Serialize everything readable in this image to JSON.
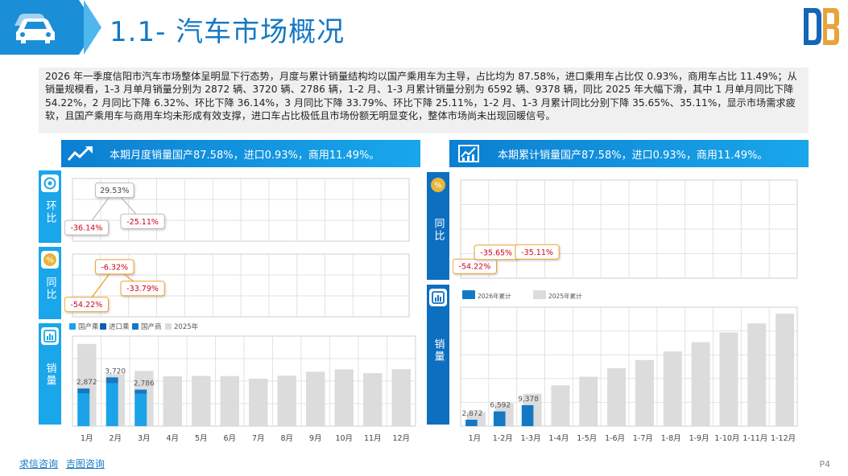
{
  "header": {
    "title": "1.1- 汽车市场概况"
  },
  "summary": "2026 年一季度信阳市汽车市场整体呈明显下行态势，月度与累计销量结构均以国产乘用车为主导，占比均为 87.58%，进口乘用车占比仅 0.93%，商用车占比 11.49%；从销量规模看，1-3 月单月销量分别为 2872 辆、3720 辆、2786 辆，1-2 月、1-3 月累计销量分别为 6592 辆、9378 辆，同比 2025 年大幅下滑，其中 1 月单月同比下降 54.22%，2 月同比下降 6.32%、环比下降 36.14%，3 月同比下降 33.79%、环比下降 25.11%，1-2 月、1-3 月累计同比分别下降 35.65%、35.11%，显示市场需求疲软，且国产乘用车与商用车均未形成有效支撑，进口车占比极低且市场份额无明显变化，整体市场尚未出现回暖信号。",
  "left_panel": {
    "banner": "本期月度销量国产87.58%，进口0.93%，商用11.49%。",
    "tab_mom": "环比",
    "tab_yoy": "同比",
    "tab_sales": "销量"
  },
  "right_panel": {
    "banner": "本期累计销量国产87.58%，进口0.93%，商用11.49%。",
    "tab_yoy": "同比",
    "tab_sales": "销量"
  },
  "footer": {
    "link1": "求信咨询",
    "link2": "吉图咨询",
    "page": "P4"
  },
  "colors": {
    "accent": "#1a8fd8",
    "domestic": "#1aa3e8",
    "import": "#0d5fb0",
    "commercial": "#1479c4",
    "prev_year": "#dcdcdc",
    "negative_label": "#d0021b"
  },
  "chart_data": [
    {
      "id": "monthly_mom",
      "type": "line",
      "categories": [
        "1月",
        "2月",
        "3月",
        "4月",
        "5月",
        "6月",
        "7月",
        "8月",
        "9月",
        "10月",
        "11月",
        "12月"
      ],
      "series": [
        {
          "values": [
            -36.14,
            29.53,
            -25.11,
            null,
            null,
            null,
            null,
            null,
            null,
            null,
            null,
            null
          ]
        }
      ],
      "data_labels": [
        "-36.14%",
        "29.53%",
        "-25.11%"
      ]
    },
    {
      "id": "monthly_yoy",
      "type": "line",
      "categories": [
        "1月",
        "2月",
        "3月",
        "4月",
        "5月",
        "6月",
        "7月",
        "8月",
        "9月",
        "10月",
        "11月",
        "12月"
      ],
      "series": [
        {
          "values": [
            -54.22,
            -6.32,
            -33.79,
            null,
            null,
            null,
            null,
            null,
            null,
            null,
            null,
            null
          ]
        }
      ],
      "data_labels": [
        "-54.22%",
        "-6.32%",
        "-33.79%"
      ]
    },
    {
      "id": "monthly_sales",
      "type": "bar",
      "categories": [
        "1月",
        "2月",
        "3月",
        "4月",
        "5月",
        "6月",
        "7月",
        "8月",
        "9月",
        "10月",
        "11月",
        "12月"
      ],
      "legend": [
        "国产乘",
        "进口乘",
        "国产商",
        "2025年"
      ],
      "series": [
        {
          "name": "2025年",
          "values": [
            6270,
            3970,
            4210,
            3800,
            3830,
            3820,
            3620,
            3850,
            4150,
            4330,
            4040,
            4350
          ]
        },
        {
          "name": "2026年",
          "values": [
            2872,
            3720,
            2786,
            null,
            null,
            null,
            null,
            null,
            null,
            null,
            null,
            null
          ]
        }
      ],
      "data_labels": [
        "2,872",
        "3,720",
        "2,786"
      ]
    },
    {
      "id": "cumulative_yoy",
      "type": "line",
      "categories": [
        "1月",
        "1-2月",
        "1-3月",
        "1-4月",
        "1-5月",
        "1-6月",
        "1-7月",
        "1-8月",
        "1-9月",
        "1-10月",
        "1-11月",
        "1-12月"
      ],
      "series": [
        {
          "values": [
            -54.22,
            -35.65,
            -35.11,
            null,
            null,
            null,
            null,
            null,
            null,
            null,
            null,
            null
          ]
        }
      ],
      "data_labels": [
        "-54.22%",
        "-35.65%",
        "-35.11%"
      ]
    },
    {
      "id": "cumulative_sales",
      "type": "bar",
      "categories": [
        "1月",
        "1-2月",
        "1-3月",
        "1-4月",
        "1-5月",
        "1-6月",
        "1-7月",
        "1-8月",
        "1-9月",
        "1-10月",
        "1-11月",
        "1-12月"
      ],
      "legend": [
        "2026年累计",
        "2025年累计"
      ],
      "series": [
        {
          "name": "2025年累计",
          "values": [
            6270,
            10240,
            14450,
            18250,
            22080,
            25900,
            29520,
            33370,
            37520,
            41850,
            45890,
            50240
          ]
        },
        {
          "name": "2026年累计",
          "values": [
            2872,
            6592,
            9378,
            null,
            null,
            null,
            null,
            null,
            null,
            null,
            null,
            null
          ]
        }
      ],
      "data_labels": [
        "2,872",
        "6,592",
        "9,378"
      ]
    }
  ]
}
